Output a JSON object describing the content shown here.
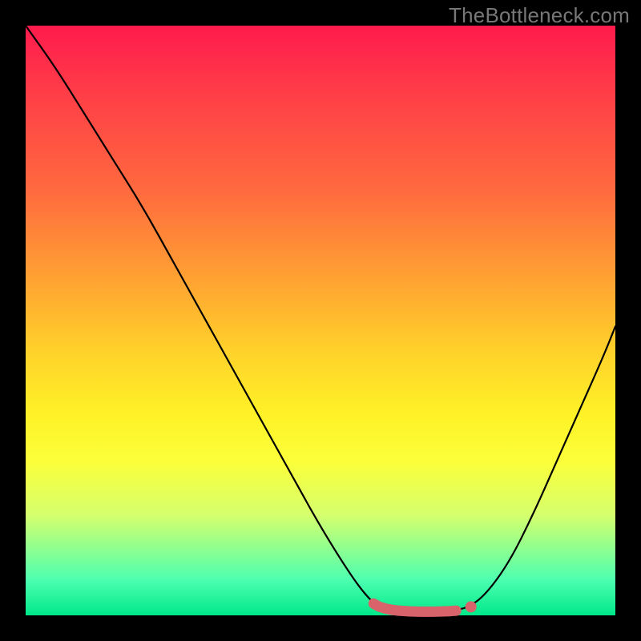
{
  "attribution": "TheBottleneck.com",
  "chart_data": {
    "type": "line",
    "title": "",
    "xlabel": "",
    "ylabel": "",
    "xlim": [
      0,
      100
    ],
    "ylim": [
      0,
      100
    ],
    "grid": false,
    "legend": false,
    "curve": {
      "name": "mismatch-curve",
      "stroke": "#000000",
      "points": [
        {
          "x": 0,
          "y": 100
        },
        {
          "x": 5,
          "y": 93
        },
        {
          "x": 10,
          "y": 85
        },
        {
          "x": 15,
          "y": 77
        },
        {
          "x": 20,
          "y": 69
        },
        {
          "x": 25,
          "y": 60
        },
        {
          "x": 30,
          "y": 51
        },
        {
          "x": 35,
          "y": 42
        },
        {
          "x": 40,
          "y": 33
        },
        {
          "x": 45,
          "y": 24
        },
        {
          "x": 50,
          "y": 15
        },
        {
          "x": 55,
          "y": 7
        },
        {
          "x": 58,
          "y": 3
        },
        {
          "x": 60,
          "y": 1.4
        },
        {
          "x": 63,
          "y": 0.8
        },
        {
          "x": 66,
          "y": 0.6
        },
        {
          "x": 69,
          "y": 0.6
        },
        {
          "x": 72,
          "y": 0.7
        },
        {
          "x": 75,
          "y": 1.3
        },
        {
          "x": 78,
          "y": 3.5
        },
        {
          "x": 82,
          "y": 9
        },
        {
          "x": 86,
          "y": 17
        },
        {
          "x": 90,
          "y": 26
        },
        {
          "x": 94,
          "y": 35
        },
        {
          "x": 98,
          "y": 44
        },
        {
          "x": 100,
          "y": 49
        }
      ]
    },
    "highlight": {
      "name": "optimal-range",
      "stroke": "#d9636a",
      "endpoint_fill": "#d9636a",
      "points": [
        {
          "x": 59,
          "y": 2.0
        },
        {
          "x": 60,
          "y": 1.45
        },
        {
          "x": 61,
          "y": 1.15
        },
        {
          "x": 62,
          "y": 0.95
        },
        {
          "x": 63,
          "y": 0.82
        },
        {
          "x": 65,
          "y": 0.68
        },
        {
          "x": 67,
          "y": 0.62
        },
        {
          "x": 69,
          "y": 0.62
        },
        {
          "x": 71,
          "y": 0.68
        },
        {
          "x": 72,
          "y": 0.72
        },
        {
          "x": 73,
          "y": 0.8
        }
      ],
      "right_marker": {
        "x": 75.5,
        "y": 1.45
      }
    }
  }
}
